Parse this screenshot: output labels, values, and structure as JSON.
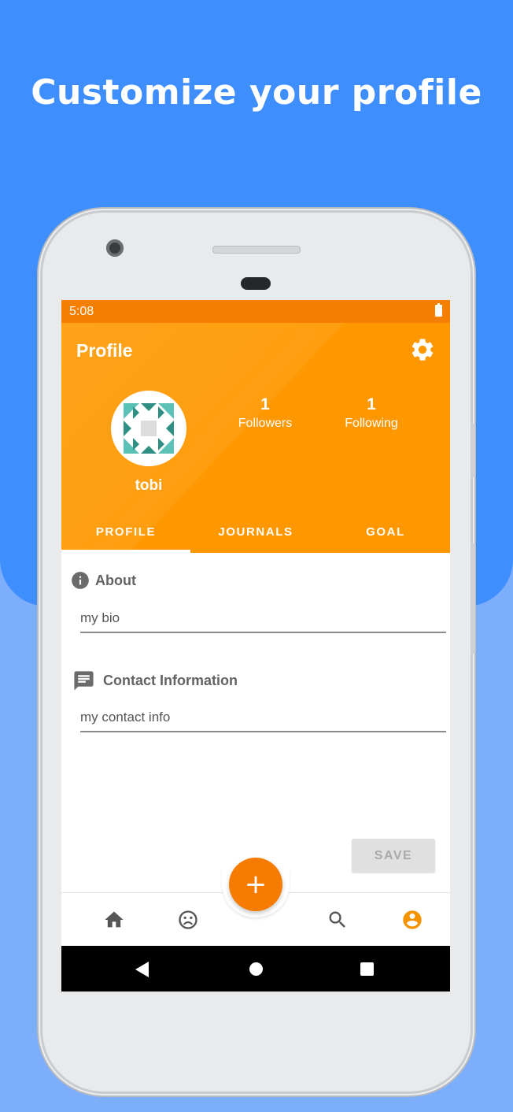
{
  "headline": "Customize your profile",
  "colors": {
    "top_background": "#3f8efd",
    "bottom_background": "#7caefc",
    "accent": "#ff9800",
    "status_bar": "#f57f00",
    "fab": "#f57c00"
  },
  "status_bar": {
    "time": "5:08",
    "battery_icon": "battery-full"
  },
  "header": {
    "title": "Profile",
    "settings_icon": "gear",
    "username": "tobi",
    "stats": {
      "followers": {
        "count": "1",
        "label": "Followers"
      },
      "following": {
        "count": "1",
        "label": "Following"
      }
    }
  },
  "tabs": [
    {
      "label": "PROFILE",
      "active": true
    },
    {
      "label": "JOURNALS",
      "active": false
    },
    {
      "label": "GOAL",
      "active": false
    }
  ],
  "about": {
    "title": "About",
    "icon": "info",
    "value": "",
    "placeholder": "my bio"
  },
  "contact": {
    "title": "Contact Information",
    "icon": "message",
    "value": "",
    "placeholder": "my contact info"
  },
  "save_label": "SAVE",
  "fab_label": "+",
  "bottom_nav": {
    "items": [
      "home",
      "mood",
      "search",
      "account"
    ],
    "active": "account"
  },
  "android_nav": [
    "back",
    "home",
    "recents"
  ]
}
